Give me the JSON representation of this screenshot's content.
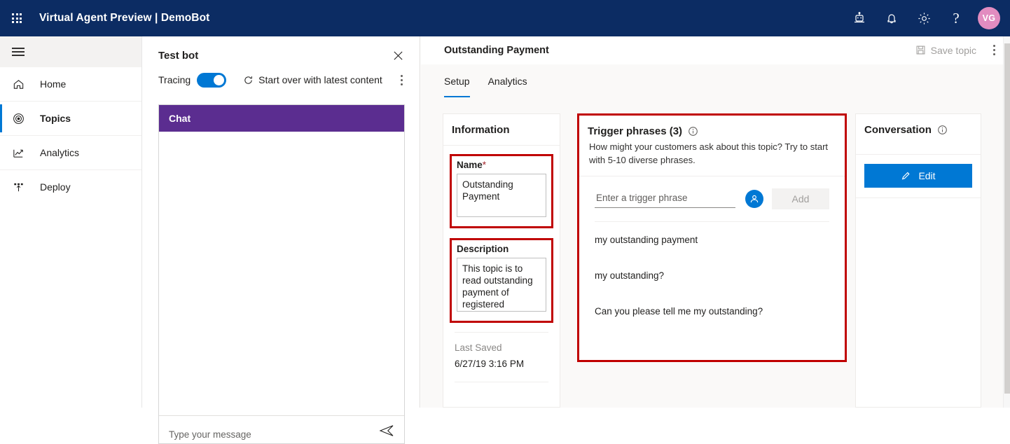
{
  "topbar": {
    "waffle_icon": "app-launcher-icon",
    "title": "Virtual Agent Preview | DemoBot",
    "icons": [
      {
        "name": "bot-icon",
        "label": "Bot"
      },
      {
        "name": "bell-icon",
        "label": "Notifications"
      },
      {
        "name": "gear-icon",
        "label": "Settings"
      },
      {
        "name": "help-icon",
        "label": "?"
      }
    ],
    "avatar_initials": "VG",
    "avatar_color": "#e28cc0",
    "background_color": "#0c2c63"
  },
  "sidebar": {
    "hamburger": "hamburger-menu-icon",
    "items": [
      {
        "label": "Home",
        "icon": "home-icon",
        "selected": false
      },
      {
        "label": "Topics",
        "icon": "topics-icon",
        "selected": true
      },
      {
        "label": "Analytics",
        "icon": "analytics-icon",
        "selected": false
      },
      {
        "label": "Deploy",
        "icon": "deploy-icon",
        "selected": false
      }
    ],
    "selected_accent": "#0078d4"
  },
  "test_bot": {
    "title": "Test bot",
    "close_icon": "close-icon",
    "tracing_label": "Tracing",
    "tracing_on": true,
    "start_over_label": "Start over with latest content",
    "refresh_icon": "refresh-icon",
    "more_icon": "more-vertical-icon",
    "chat_header": "Chat",
    "chat_header_color": "#5b2d90",
    "message_placeholder": "Type your message",
    "send_icon": "send-icon"
  },
  "main": {
    "title": "Outstanding Payment",
    "save_label": "Save topic",
    "save_icon": "save-disk-icon",
    "save_enabled": false,
    "more_icon": "more-vertical-icon",
    "tabs": [
      {
        "label": "Setup",
        "active": true
      },
      {
        "label": "Analytics",
        "active": false
      }
    ]
  },
  "information_panel": {
    "title": "Information",
    "name_label": "Name",
    "name_required_mark": "*",
    "name_value": "Outstanding Payment",
    "description_label": "Description",
    "description_value": "This topic is to read outstanding payment of registered customer.",
    "last_saved_label": "Last Saved",
    "last_saved_value": "6/27/19 3:16 PM"
  },
  "trigger_panel": {
    "title": "Trigger phrases (3)",
    "info_icon": "info-icon",
    "description": "How might your customers ask about this topic? Try to start with 5-10 diverse phrases.",
    "input_placeholder": "Enter a trigger phrase",
    "input_value": "",
    "person_icon": "person-circle-icon",
    "add_label": "Add",
    "add_enabled": false,
    "phrases": [
      "my outstanding payment",
      "my outstanding?",
      "Can you please tell me my outstanding?"
    ]
  },
  "conversation_panel": {
    "title": "Conversation",
    "info_icon": "info-icon",
    "edit_label": "Edit",
    "edit_icon": "pencil-icon",
    "edit_color": "#0078d4"
  },
  "annotations": {
    "highlight_color": "#c00000",
    "boxes": [
      "name-field",
      "description-field",
      "trigger-phrases-panel"
    ]
  }
}
